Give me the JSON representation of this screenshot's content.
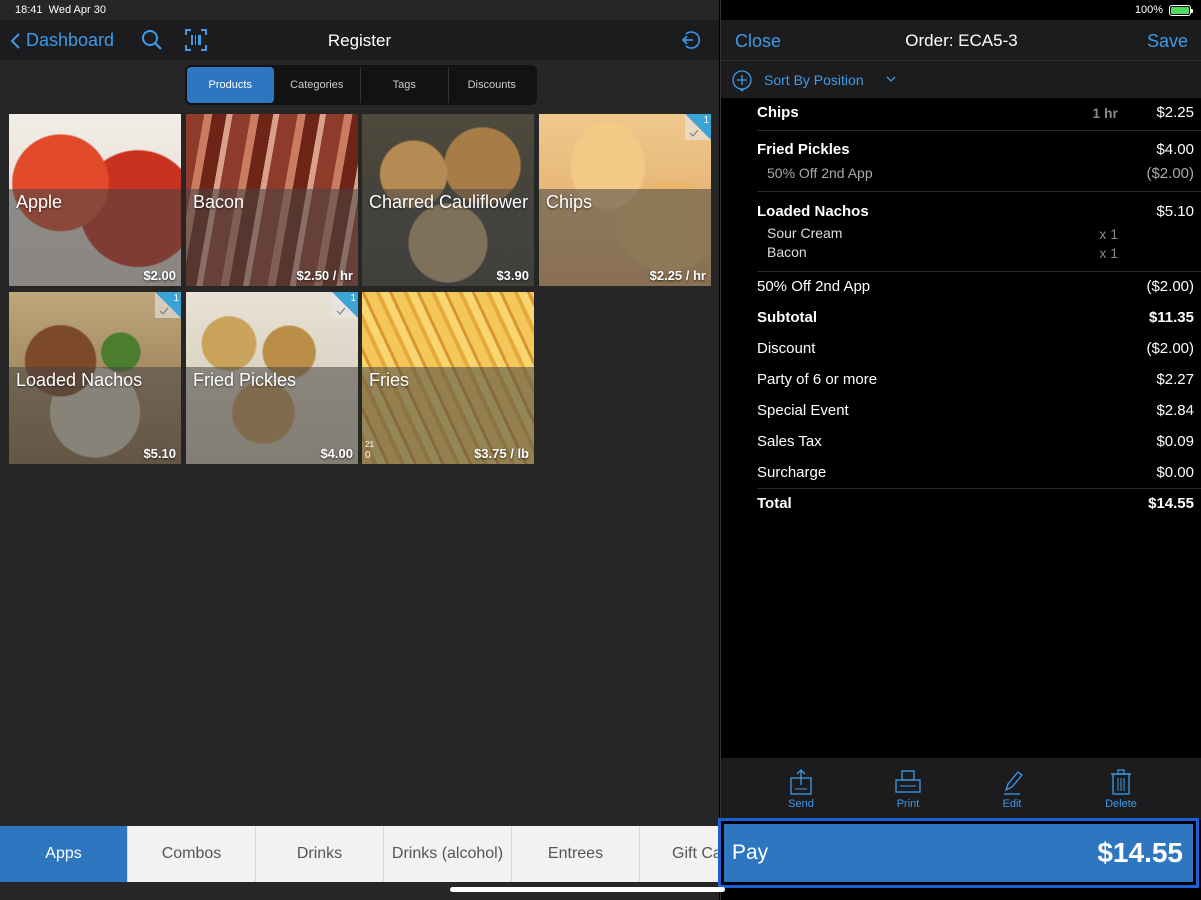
{
  "status_bar": {
    "time": "18:41",
    "date": "Wed Apr 30",
    "battery": "100%"
  },
  "left_header": {
    "back_label": "Dashboard",
    "title": "Register"
  },
  "segments": [
    "Products",
    "Categories",
    "Tags",
    "Discounts"
  ],
  "products": [
    {
      "name": "Apple",
      "price": "$2.00"
    },
    {
      "name": "Bacon",
      "price": "$2.50 / hr"
    },
    {
      "name": "Charred Cauliflower",
      "price": "$3.90"
    },
    {
      "name": "Chips",
      "price": "$2.25 / hr",
      "badge": "1"
    },
    {
      "name": "Loaded Nachos",
      "price": "$5.10",
      "badge": "1"
    },
    {
      "name": "Fried Pickles",
      "price": "$4.00",
      "badge": "1"
    },
    {
      "name": "Fries",
      "price": "$3.75 / lb",
      "stock_top": "21",
      "stock_bottom": "0"
    }
  ],
  "categories": [
    "Apps",
    "Combos",
    "Drinks",
    "Drinks (alcohol)",
    "Entrees",
    "Gift Ca"
  ],
  "right_header": {
    "close_label": "Close",
    "title": "Order: ECA5-3",
    "save_label": "Save"
  },
  "sort": {
    "label": "Sort By Position"
  },
  "order": {
    "chips": {
      "name": "Chips",
      "qty": "1 hr",
      "price": "$2.25"
    },
    "pickles": {
      "name": "Fried Pickles",
      "price": "$4.00",
      "discount_name": "50% Off 2nd App",
      "discount_amount": "($2.00)"
    },
    "nachos": {
      "name": "Loaded Nachos",
      "price": "$5.10",
      "modifiers": [
        {
          "name": "Sour Cream",
          "qty": "x 1"
        },
        {
          "name": "Bacon",
          "qty": "x 1"
        }
      ]
    }
  },
  "totals": {
    "order_discount": {
      "label": "50% Off 2nd App",
      "value": "($2.00)"
    },
    "subtotal": {
      "label": "Subtotal",
      "value": "$11.35"
    },
    "discount": {
      "label": "Discount",
      "value": "($2.00)"
    },
    "party": {
      "label": "Party of 6 or more",
      "value": "$2.27"
    },
    "special": {
      "label": "Special Event",
      "value": "$2.84"
    },
    "tax": {
      "label": "Sales Tax",
      "value": "$0.09"
    },
    "surcharge": {
      "label": "Surcharge",
      "value": "$0.00"
    },
    "total": {
      "label": "Total",
      "value": "$14.55"
    }
  },
  "actions": {
    "send": "Send",
    "print": "Print",
    "edit": "Edit",
    "delete": "Delete"
  },
  "pay": {
    "label": "Pay",
    "amount": "$14.55"
  },
  "colors": {
    "accent": "#3d9be9",
    "active_blue": "#2f76c0",
    "badge": "#3ba3d6"
  }
}
